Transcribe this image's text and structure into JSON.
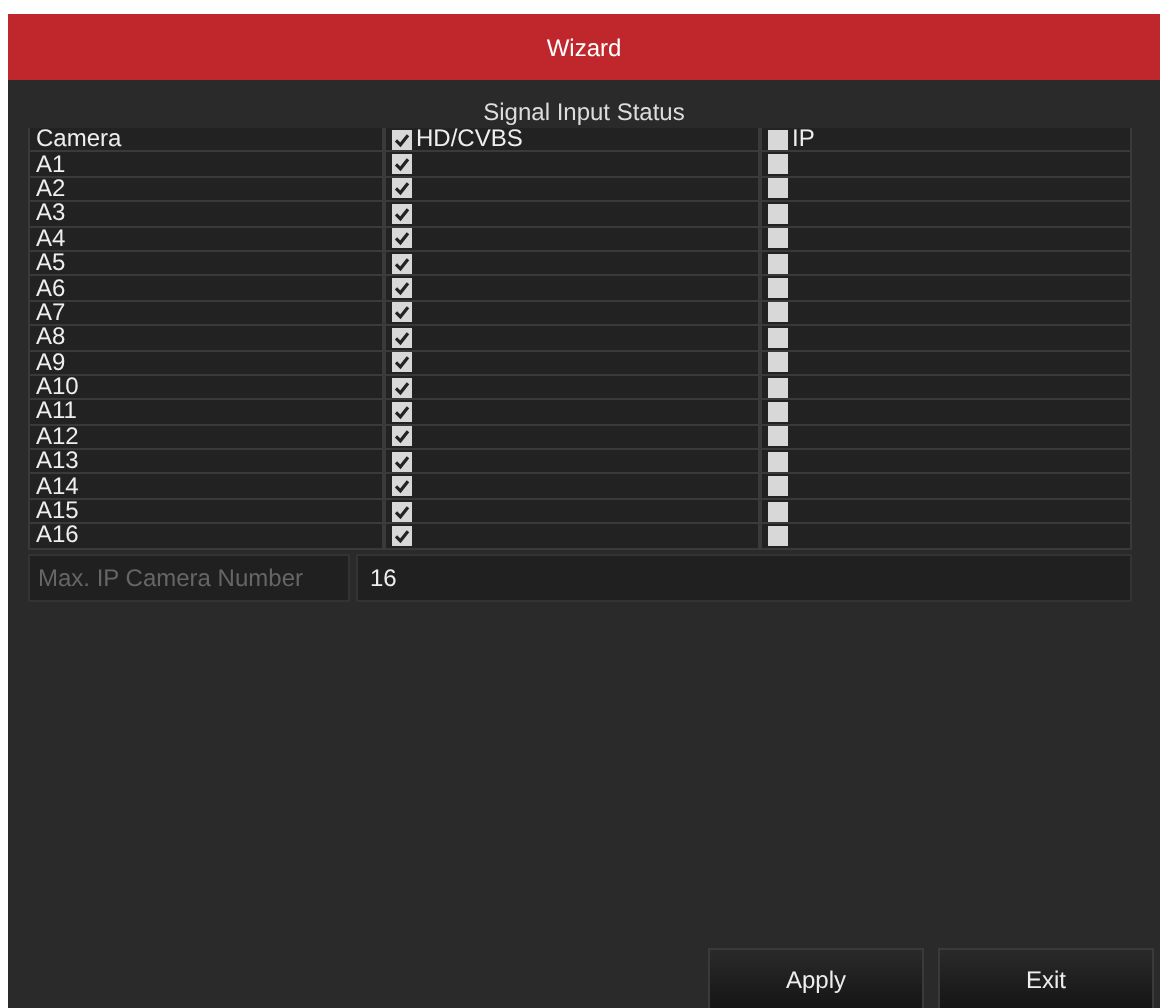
{
  "window": {
    "title": "Wizard"
  },
  "section_title": "Signal Input Status",
  "header": {
    "camera": "Camera",
    "hd_cvbs": {
      "label": "HD/CVBS",
      "checked": true
    },
    "ip": {
      "label": "IP",
      "checked": false
    }
  },
  "rows": [
    {
      "camera": "A1",
      "hd_cvbs": true,
      "ip": false
    },
    {
      "camera": "A2",
      "hd_cvbs": true,
      "ip": false
    },
    {
      "camera": "A3",
      "hd_cvbs": true,
      "ip": false
    },
    {
      "camera": "A4",
      "hd_cvbs": true,
      "ip": false
    },
    {
      "camera": "A5",
      "hd_cvbs": true,
      "ip": false
    },
    {
      "camera": "A6",
      "hd_cvbs": true,
      "ip": false
    },
    {
      "camera": "A7",
      "hd_cvbs": true,
      "ip": false
    },
    {
      "camera": "A8",
      "hd_cvbs": true,
      "ip": false
    },
    {
      "camera": "A9",
      "hd_cvbs": true,
      "ip": false
    },
    {
      "camera": "A10",
      "hd_cvbs": true,
      "ip": false
    },
    {
      "camera": "A11",
      "hd_cvbs": true,
      "ip": false
    },
    {
      "camera": "A12",
      "hd_cvbs": true,
      "ip": false
    },
    {
      "camera": "A13",
      "hd_cvbs": true,
      "ip": false
    },
    {
      "camera": "A14",
      "hd_cvbs": true,
      "ip": false
    },
    {
      "camera": "A15",
      "hd_cvbs": true,
      "ip": false
    },
    {
      "camera": "A16",
      "hd_cvbs": true,
      "ip": false
    }
  ],
  "max_ip_camera": {
    "label": "Max. IP Camera Number",
    "value": "16"
  },
  "buttons": [
    "Apply",
    "Exit"
  ]
}
